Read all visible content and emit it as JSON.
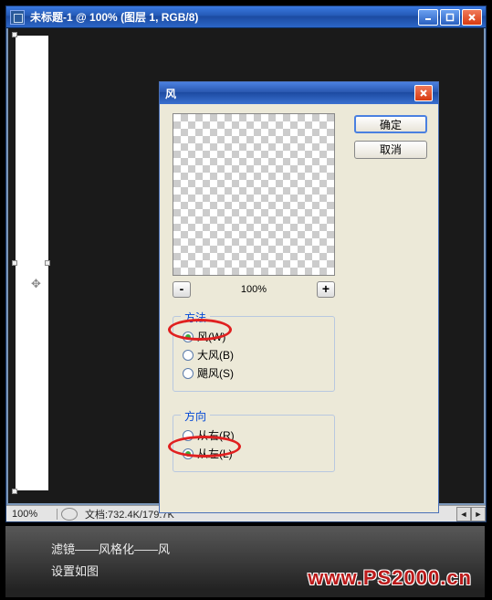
{
  "window": {
    "title": "未标题-1 @ 100% (图层 1, RGB/8)"
  },
  "status": {
    "zoom": "100%",
    "doc_size": "文档:732.4K/179.7K"
  },
  "dialog": {
    "title": "风",
    "ok": "确定",
    "cancel": "取消",
    "preview_zoom": "100%",
    "zoom_out": "-",
    "zoom_in": "+",
    "method": {
      "legend": "方法",
      "options": [
        {
          "label": "风(W)",
          "checked": true
        },
        {
          "label": "大风(B)",
          "checked": false
        },
        {
          "label": "飓风(S)",
          "checked": false
        }
      ]
    },
    "direction": {
      "legend": "方向",
      "options": [
        {
          "label": "从右(R)",
          "checked": false
        },
        {
          "label": "从左(L)",
          "checked": true
        }
      ]
    }
  },
  "caption": {
    "line1": "滤镜——风格化——风",
    "line2": "设置如图"
  },
  "watermark": "www.PS2000.cn"
}
